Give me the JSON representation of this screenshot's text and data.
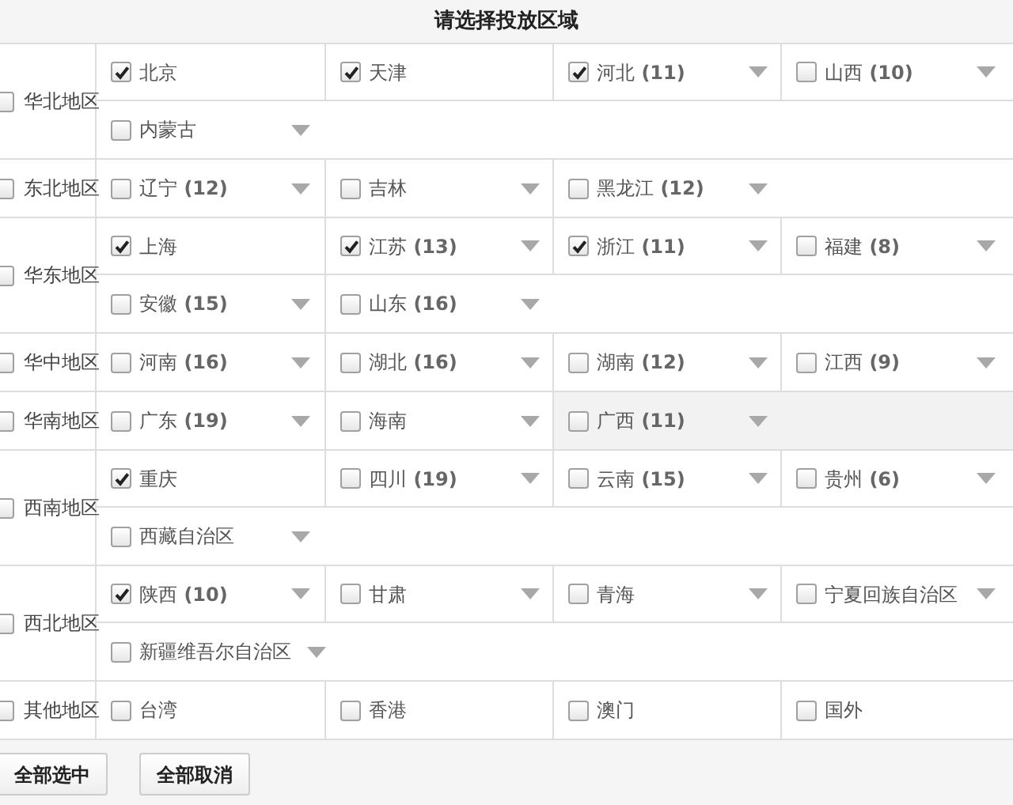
{
  "title": "请选择投放区域",
  "regions": [
    {
      "name": "华北地区",
      "checked": false,
      "lines": [
        [
          {
            "name": "北京",
            "checked": true,
            "expandable": false,
            "highlighted": false
          },
          {
            "name": "天津",
            "checked": true,
            "expandable": false,
            "highlighted": false
          },
          {
            "name": "河北",
            "count": "(11)",
            "checked": true,
            "expandable": true,
            "highlighted": false
          },
          {
            "name": "山西",
            "count": "(10)",
            "checked": false,
            "expandable": true,
            "highlighted": false
          }
        ],
        [
          {
            "name": "内蒙古",
            "checked": false,
            "expandable": true,
            "highlighted": false
          }
        ]
      ]
    },
    {
      "name": "东北地区",
      "checked": false,
      "lines": [
        [
          {
            "name": "辽宁",
            "count": "(12)",
            "checked": false,
            "expandable": true,
            "highlighted": false
          },
          {
            "name": "吉林",
            "checked": false,
            "expandable": true,
            "highlighted": false
          },
          {
            "name": "黑龙江",
            "count": "(12)",
            "checked": false,
            "expandable": true,
            "highlighted": false
          }
        ]
      ]
    },
    {
      "name": "华东地区",
      "checked": false,
      "lines": [
        [
          {
            "name": "上海",
            "checked": true,
            "expandable": false,
            "highlighted": false
          },
          {
            "name": "江苏",
            "count": "(13)",
            "checked": true,
            "expandable": true,
            "highlighted": false
          },
          {
            "name": "浙江",
            "count": "(11)",
            "checked": true,
            "expandable": true,
            "highlighted": false
          },
          {
            "name": "福建",
            "count": "(8)",
            "checked": false,
            "expandable": true,
            "highlighted": false
          }
        ],
        [
          {
            "name": "安徽",
            "count": "(15)",
            "checked": false,
            "expandable": true,
            "highlighted": false
          },
          {
            "name": "山东",
            "count": "(16)",
            "checked": false,
            "expandable": true,
            "highlighted": false
          }
        ]
      ]
    },
    {
      "name": "华中地区",
      "checked": false,
      "lines": [
        [
          {
            "name": "河南",
            "count": "(16)",
            "checked": false,
            "expandable": true,
            "highlighted": false
          },
          {
            "name": "湖北",
            "count": "(16)",
            "checked": false,
            "expandable": true,
            "highlighted": false
          },
          {
            "name": "湖南",
            "count": "(12)",
            "checked": false,
            "expandable": true,
            "highlighted": false
          },
          {
            "name": "江西",
            "count": "(9)",
            "checked": false,
            "expandable": true,
            "highlighted": false
          }
        ]
      ]
    },
    {
      "name": "华南地区",
      "checked": false,
      "lines": [
        [
          {
            "name": "广东",
            "count": "(19)",
            "checked": false,
            "expandable": true,
            "highlighted": false
          },
          {
            "name": "海南",
            "checked": false,
            "expandable": true,
            "highlighted": false
          },
          {
            "name": "广西",
            "count": "(11)",
            "checked": false,
            "expandable": true,
            "highlighted": true
          }
        ]
      ]
    },
    {
      "name": "西南地区",
      "checked": false,
      "lines": [
        [
          {
            "name": "重庆",
            "checked": true,
            "expandable": false,
            "highlighted": false
          },
          {
            "name": "四川",
            "count": "(19)",
            "checked": false,
            "expandable": true,
            "highlighted": false
          },
          {
            "name": "云南",
            "count": "(15)",
            "checked": false,
            "expandable": true,
            "highlighted": false
          },
          {
            "name": "贵州",
            "count": "(6)",
            "checked": false,
            "expandable": true,
            "highlighted": false
          }
        ],
        [
          {
            "name": "西藏自治区",
            "checked": false,
            "expandable": true,
            "highlighted": false
          }
        ]
      ]
    },
    {
      "name": "西北地区",
      "checked": false,
      "lines": [
        [
          {
            "name": "陕西",
            "count": "(10)",
            "checked": true,
            "expandable": true,
            "highlighted": false
          },
          {
            "name": "甘肃",
            "checked": false,
            "expandable": true,
            "highlighted": false
          },
          {
            "name": "青海",
            "checked": false,
            "expandable": true,
            "highlighted": false
          },
          {
            "name": "宁夏回族自治区",
            "checked": false,
            "expandable": true,
            "highlighted": false
          }
        ],
        [
          {
            "name": "新疆维吾尔自治区",
            "checked": false,
            "expandable": true,
            "highlighted": false
          }
        ]
      ]
    },
    {
      "name": "其他地区",
      "checked": false,
      "lines": [
        [
          {
            "name": "台湾",
            "checked": false,
            "expandable": false,
            "highlighted": false
          },
          {
            "name": "香港",
            "checked": false,
            "expandable": false,
            "highlighted": false
          },
          {
            "name": "澳门",
            "checked": false,
            "expandable": false,
            "highlighted": false
          },
          {
            "name": "国外",
            "checked": false,
            "expandable": false,
            "highlighted": false
          }
        ]
      ]
    }
  ],
  "buttons": [
    "全部选中",
    "全部取消"
  ]
}
